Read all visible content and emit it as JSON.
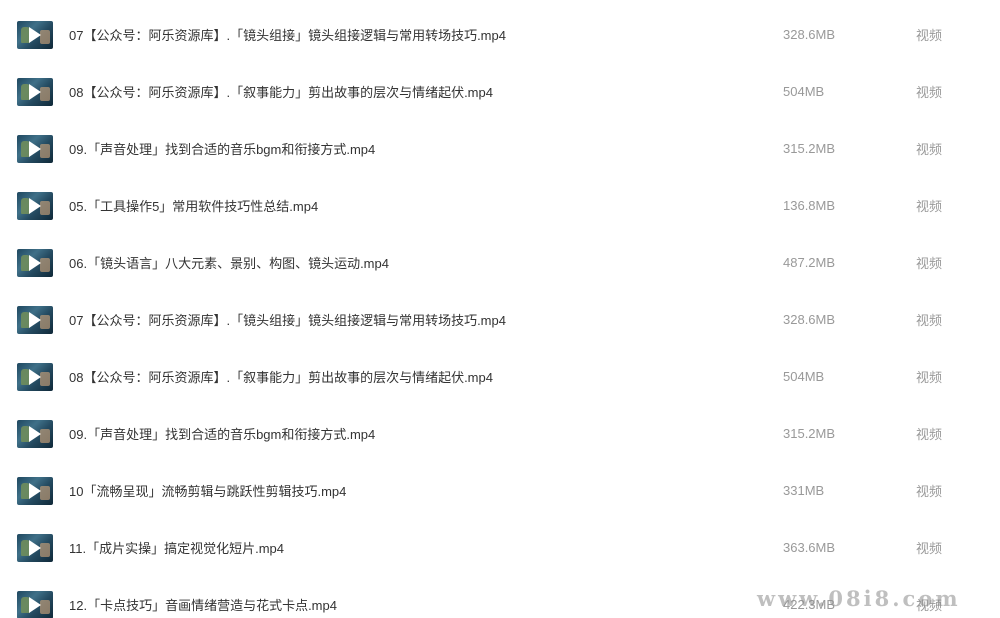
{
  "files": [
    {
      "name": "07【公众号：阿乐资源库】.「镜头组接」镜头组接逻辑与常用转场技巧.mp4",
      "size": "328.6MB",
      "type": "视频"
    },
    {
      "name": "08【公众号：阿乐资源库】.「叙事能力」剪出故事的层次与情绪起伏.mp4",
      "size": "504MB",
      "type": "视频"
    },
    {
      "name": "09.「声音处理」找到合适的音乐bgm和衔接方式.mp4",
      "size": "315.2MB",
      "type": "视频"
    },
    {
      "name": "05.「工具操作5」常用软件技巧性总结.mp4",
      "size": "136.8MB",
      "type": "视频"
    },
    {
      "name": "06.「镜头语言」八大元素、景别、构图、镜头运动.mp4",
      "size": "487.2MB",
      "type": "视频"
    },
    {
      "name": "07【公众号：阿乐资源库】.「镜头组接」镜头组接逻辑与常用转场技巧.mp4",
      "size": "328.6MB",
      "type": "视频"
    },
    {
      "name": "08【公众号：阿乐资源库】.「叙事能力」剪出故事的层次与情绪起伏.mp4",
      "size": "504MB",
      "type": "视频"
    },
    {
      "name": "09.「声音处理」找到合适的音乐bgm和衔接方式.mp4",
      "size": "315.2MB",
      "type": "视频"
    },
    {
      "name": "10「流畅呈现」流畅剪辑与跳跃性剪辑技巧.mp4",
      "size": "331MB",
      "type": "视频"
    },
    {
      "name": "11.「成片实操」搞定视觉化短片.mp4",
      "size": "363.6MB",
      "type": "视频"
    },
    {
      "name": "12.「卡点技巧」音画情绪营造与花式卡点.mp4",
      "size": "422.3MB",
      "type": "视频"
    }
  ],
  "watermark": "www.08i8.com",
  "colors": {
    "name_text": "#333333",
    "meta_text": "#999999",
    "background": "#ffffff"
  },
  "icons": {
    "thumbnail": "video-thumbnail-icon",
    "play": "play-icon"
  }
}
